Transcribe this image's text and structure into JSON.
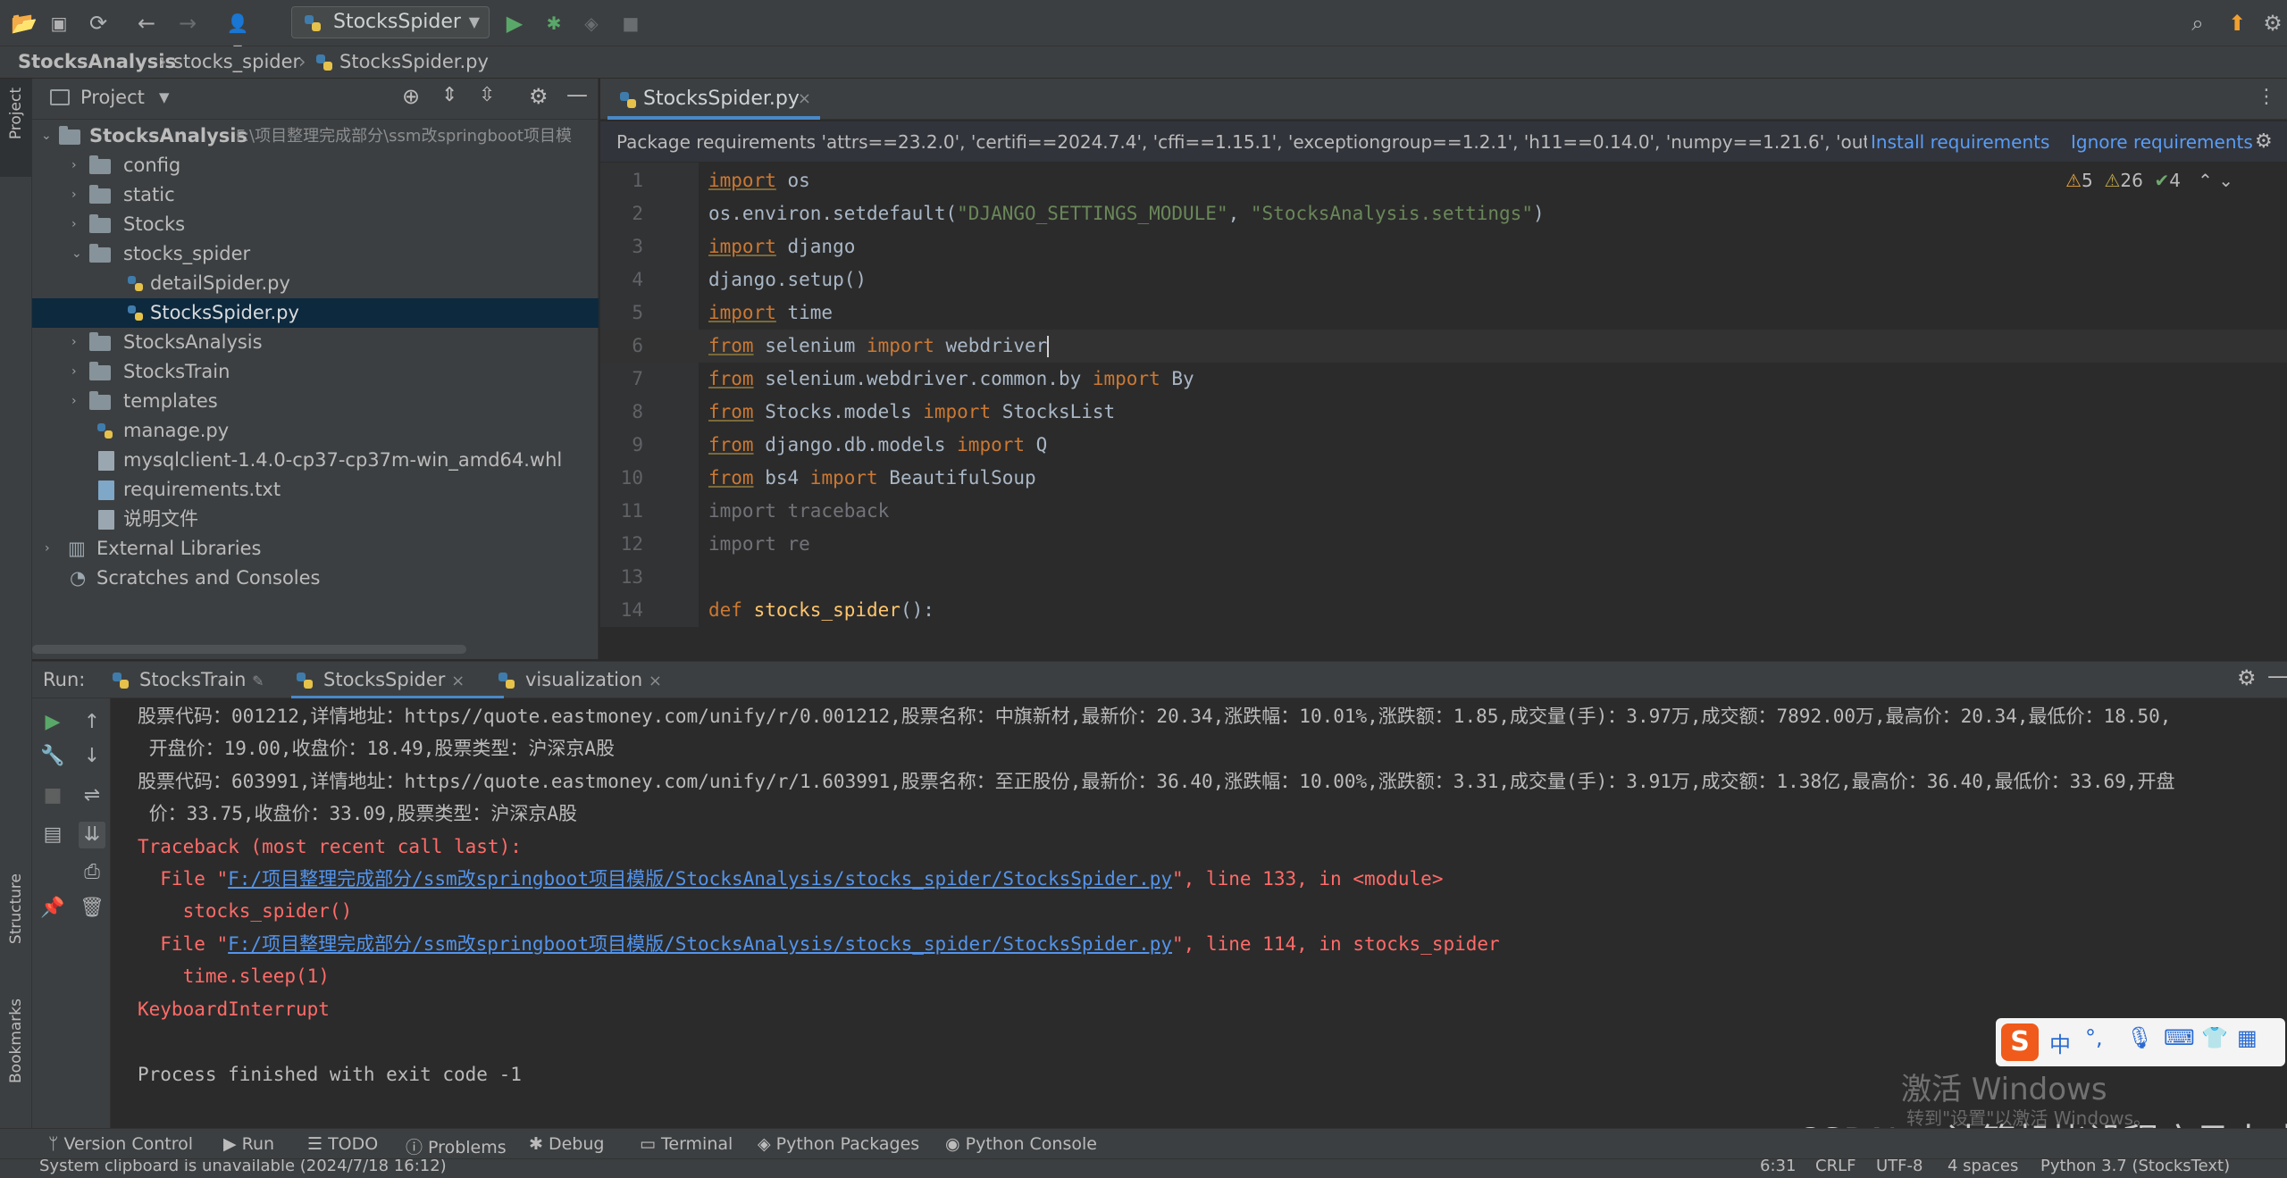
{
  "toolbar": {
    "run_config": "StocksSpider",
    "icons": [
      "open-folder-icon",
      "save-icon",
      "sync-icon",
      "back-icon",
      "forward-icon",
      "user-icon",
      "run-icon",
      "debug-icon",
      "coverage-icon",
      "stop-icon",
      "search-icon",
      "update-icon",
      "settings-icon"
    ]
  },
  "breadcrumb": {
    "items": [
      "StocksAnalysis",
      "stocks_spider",
      "StocksSpider.py"
    ]
  },
  "left_strip": {
    "project": "Project",
    "structure": "Structure",
    "bookmarks": "Bookmarks"
  },
  "project": {
    "header": "Project",
    "root_name": "StocksAnalysis",
    "root_path": "F:\\项目整理完成部分\\ssm改springboot项目模",
    "items": [
      {
        "label": "config",
        "type": "folder"
      },
      {
        "label": "static",
        "type": "folder"
      },
      {
        "label": "Stocks",
        "type": "folder"
      },
      {
        "label": "stocks_spider",
        "type": "folder"
      },
      {
        "label": "detailSpider.py",
        "type": "py"
      },
      {
        "label": "StocksSpider.py",
        "type": "py"
      },
      {
        "label": "StocksAnalysis",
        "type": "folder"
      },
      {
        "label": "StocksTrain",
        "type": "folder"
      },
      {
        "label": "templates",
        "type": "folder"
      },
      {
        "label": "manage.py",
        "type": "py"
      },
      {
        "label": "mysqlclient-1.4.0-cp37-cp37m-win_amd64.whl",
        "type": "file"
      },
      {
        "label": "requirements.txt",
        "type": "txt"
      },
      {
        "label": "说明文件",
        "type": "file"
      },
      {
        "label": "External Libraries",
        "type": "lib"
      },
      {
        "label": "Scratches and Consoles",
        "type": "scratch"
      }
    ]
  },
  "editor": {
    "tab": "StocksSpider.py",
    "banner_text": "Package requirements 'attrs==23.2.0', 'certifi==2024.7.4', 'cffi==1.15.1', 'exceptiongroup==1.2.1', 'h11==0.14.0', 'numpy==1.21.6', 'outcome=",
    "install": "Install requirements",
    "ignore": "Ignore requirements",
    "warnings": "5",
    "weak_warnings": "26",
    "typos": "4",
    "lines": [
      {
        "n": "1",
        "a": "import",
        "b": " os"
      },
      {
        "n": "2",
        "a": "os.environ.setdefault(",
        "s1": "\"DJANGO_SETTINGS_MODULE\"",
        "c": ", ",
        "s2": "\"StocksAnalysis.settings\"",
        "d": ")"
      },
      {
        "n": "3",
        "a": "import",
        "b": " django"
      },
      {
        "n": "4",
        "a": "django.setup()"
      },
      {
        "n": "5",
        "a": "import",
        "b": " time"
      },
      {
        "n": "6",
        "a": "from",
        "b": " selenium ",
        "k2": "import",
        "c": " webdriver"
      },
      {
        "n": "7",
        "a": "from",
        "b": " selenium.webdriver.common.by ",
        "k2": "import",
        "c": " By"
      },
      {
        "n": "8",
        "a": "from",
        "b": " Stocks.models ",
        "k2": "import",
        "c": " StocksList"
      },
      {
        "n": "9",
        "a": "from",
        "b": " django.db.models ",
        "k2": "import",
        "c": " Q"
      },
      {
        "n": "10",
        "a": "from",
        "b": " bs4 ",
        "k2": "import",
        "c": " BeautifulSoup"
      },
      {
        "n": "11",
        "a": "import traceback"
      },
      {
        "n": "12",
        "a": "import re"
      },
      {
        "n": "13",
        "a": ""
      },
      {
        "n": "14",
        "a": "def",
        "b": " ",
        "f": "stocks_spider",
        "c": "():"
      }
    ]
  },
  "run": {
    "label": "Run:",
    "tabs": [
      "StocksTrain",
      "StocksSpider",
      "visualization"
    ],
    "output": [
      "股票代码：001212,详情地址：https//quote.eastmoney.com/unify/r/0.001212,股票名称：中旗新材,最新价：20.34,涨跌幅：10.01%,涨跌额：1.85,成交量(手)：3.97万,成交额：7892.00万,最高价：20.34,最低价：18.50,",
      " 开盘价：19.00,收盘价：18.49,股票类型：沪深京A股",
      "股票代码：603991,详情地址：https//quote.eastmoney.com/unify/r/1.603991,股票名称：至正股份,最新价：36.40,涨跌幅：10.00%,涨跌额：3.31,成交量(手)：3.91万,成交额：1.38亿,最高价：36.40,最低价：33.69,开盘",
      " 价：33.75,收盘价：33.09,股票类型：沪深京A股"
    ],
    "traceback": "Traceback (most recent call last):",
    "file1_prefix": "  File \"",
    "file1_link": "F:/项目整理完成部分/ssm改springboot项目模版/StocksAnalysis/stocks_spider/StocksSpider.py",
    "file1_suffix": "\", line 133, in <module>",
    "code1": "    stocks_spider()",
    "file2_prefix": "  File \"",
    "file2_link": "F:/项目整理完成部分/ssm改springboot项目模版/StocksAnalysis/stocks_spider/StocksSpider.py",
    "file2_suffix": "\", line 114, in stocks_spider",
    "code2": "    time.sleep(1)",
    "interrupt": "KeyboardInterrupt",
    "finished": "Process finished with exit code -1"
  },
  "tool_tabs": [
    "Version Control",
    "Run",
    "TODO",
    "Problems",
    "Debug",
    "Terminal",
    "Python Packages",
    "Python Console"
  ],
  "status": {
    "message": "System clipboard is unavailable (2024/7/18 16:12)",
    "position": "6:31",
    "line_sep": "CRLF",
    "encoding": "UTF-8",
    "indent": "4 spaces",
    "interpreter": "Python 3.7 (StocksText)"
  },
  "overlay": {
    "activate_title": "激活 Windows",
    "activate_sub": "转到\"设置\"以激活 Windows。",
    "csdn": "CSDN @计算机毕设程序员大成哥",
    "ime": "中"
  },
  "colors": {
    "accent": "#4a88c7",
    "keyword": "#cc7832",
    "string": "#6a8759",
    "error": "#ff6b68",
    "link": "#5394ec"
  }
}
